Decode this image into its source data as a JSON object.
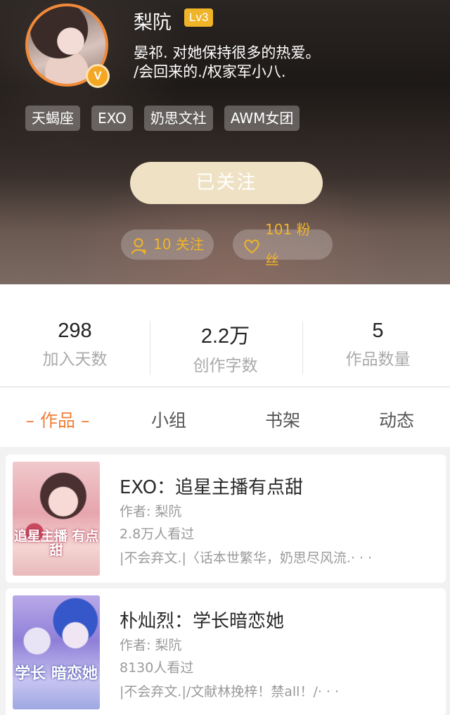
{
  "profile": {
    "username": "梨阬",
    "level": "Lv3",
    "verified_badge": "V",
    "bio_line1": "晏祁. 对她保持很多的热爱。",
    "bio_line2": "/会回来的./权家军小八.",
    "tags": [
      "天蝎座",
      "EXO",
      "奶思文社",
      "AWM女团"
    ],
    "follow_button_label": "已关注",
    "following_label": "10 关注",
    "fans_label": "101 粉丝"
  },
  "stats": [
    {
      "value": "298",
      "label": "加入天数"
    },
    {
      "value": "2.2万",
      "label": "创作字数"
    },
    {
      "value": "5",
      "label": "作品数量"
    }
  ],
  "tabs": [
    {
      "label": "– 作品 –",
      "active": true
    },
    {
      "label": "小组",
      "active": false
    },
    {
      "label": "书架",
      "active": false
    },
    {
      "label": "动态",
      "active": false
    }
  ],
  "books": [
    {
      "title": "EXO：追星主播有点甜",
      "author": "作者: 梨阬",
      "views": "2.8万人看过",
      "description": "|不会弃文.|〈话本世繁华，奶思尽风流.· · ·",
      "cover_text": "追星主播 有点甜"
    },
    {
      "title": "朴灿烈：学长暗恋她",
      "author": "作者: 梨阬",
      "views": "8130人看过",
      "description": "|不会弃文.|/文献林挽梓！禁all！/· · ·",
      "cover_text": "学长 暗恋她"
    }
  ],
  "colors": {
    "accent": "#ef7f38",
    "gold": "#f0b429",
    "avatar_ring": "#f08a3a"
  }
}
